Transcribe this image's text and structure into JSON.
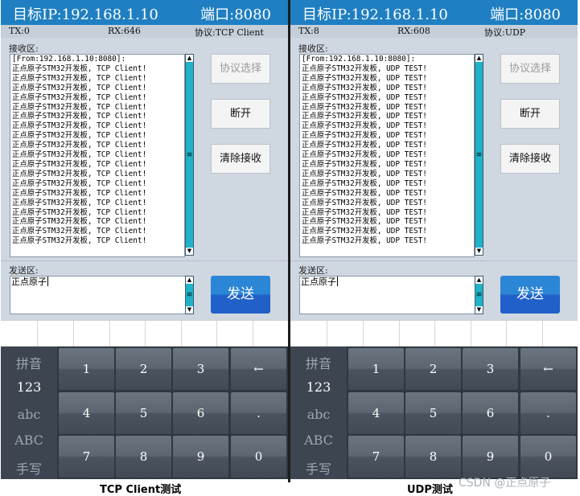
{
  "left": {
    "header": {
      "ip": "目标IP:192.168.1.10",
      "port": "端口:8080"
    },
    "status": {
      "tx": "TX:0",
      "rx": "RX:646",
      "protocol": "协议:TCP Client"
    },
    "receive_label": "接收区:",
    "receive_lines": [
      "[From:192.168.1.10:8080]:",
      "正点原子STM32开发板, TCP Client!",
      "正点原子STM32开发板, TCP Client!",
      "正点原子STM32开发板, TCP Client!",
      "正点原子STM32开发板, TCP Client!",
      "正点原子STM32开发板, TCP Client!",
      "正点原子STM32开发板, TCP Client!",
      "正点原子STM32开发板, TCP Client!",
      "正点原子STM32开发板, TCP Client!",
      "正点原子STM32开发板, TCP Client!",
      "正点原子STM32开发板, TCP Client!",
      "正点原子STM32开发板, TCP Client!",
      "正点原子STM32开发板, TCP Client!",
      "正点原子STM32开发板, TCP Client!",
      "正点原子STM32开发板, TCP Client!",
      "正点原子STM32开发板, TCP Client!",
      "正点原子STM32开发板, TCP Client!",
      "正点原子STM32开发板, TCP Client!",
      "正点原子STM32开发板, TCP Client!",
      "正点原子STM32开发板, TCP Client!"
    ],
    "buttons": {
      "protocol": "协议选择",
      "disconnect": "断开",
      "clear": "清除接收",
      "send": "发送"
    },
    "send_label": "发送区:",
    "send_text": "正点原子"
  },
  "right": {
    "header": {
      "ip": "目标IP:192.168.1.10",
      "port": "端口:8080"
    },
    "status": {
      "tx": "TX:8",
      "rx": "RX:608",
      "protocol": "协议:UDP"
    },
    "receive_label": "接收区:",
    "receive_lines": [
      "[From:192.168.1.10:8080]:",
      "正点原子STM32开发板, UDP TEST!",
      "正点原子STM32开发板, UDP TEST!",
      "正点原子STM32开发板, UDP TEST!",
      "正点原子STM32开发板, UDP TEST!",
      "正点原子STM32开发板, UDP TEST!",
      "正点原子STM32开发板, UDP TEST!",
      "正点原子STM32开发板, UDP TEST!",
      "正点原子STM32开发板, UDP TEST!",
      "正点原子STM32开发板, UDP TEST!",
      "正点原子STM32开发板, UDP TEST!",
      "正点原子STM32开发板, UDP TEST!",
      "正点原子STM32开发板, UDP TEST!",
      "正点原子STM32开发板, UDP TEST!",
      "正点原子STM32开发板, UDP TEST!",
      "正点原子STM32开发板, UDP TEST!",
      "正点原子STM32开发板, UDP TEST!",
      "正点原子STM32开发板, UDP TEST!",
      "正点原子STM32开发板, UDP TEST!",
      "正点原子STM32开发板, UDP TEST!"
    ],
    "buttons": {
      "protocol": "协议选择",
      "disconnect": "断开",
      "clear": "清除接收",
      "send": "发送"
    },
    "send_label": "发送区:",
    "send_text": "正点原子"
  },
  "keyboard": {
    "modes": [
      "拼音",
      "123",
      "abc",
      "ABC",
      "手写"
    ],
    "active_mode": "123",
    "keys": [
      "1",
      "2",
      "3",
      "←",
      "4",
      "5",
      "6",
      ".",
      "7",
      "8",
      "9",
      "0"
    ]
  },
  "captions": {
    "left": "TCP Client测试",
    "right": "UDP测试"
  },
  "watermark": "CSDN @正点原子"
}
